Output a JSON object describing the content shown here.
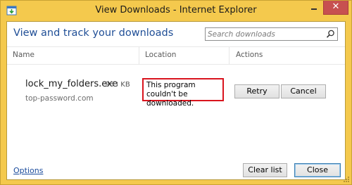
{
  "window": {
    "title": "View Downloads - Internet Explorer",
    "close_glyph": "✕"
  },
  "header": {
    "heading": "View and track your downloads",
    "search_placeholder": "Search downloads"
  },
  "columns": {
    "name": "Name",
    "location": "Location",
    "actions": "Actions"
  },
  "download": {
    "filename": "lock_my_folders.exe",
    "size": "963 KB",
    "source": "top-password.com",
    "status": "This program couldn't be downloaded.",
    "retry_label": "Retry",
    "cancel_label": "Cancel"
  },
  "footer": {
    "options_label": "Options",
    "clear_list_label": "Clear list",
    "close_label": "Close"
  },
  "colors": {
    "frame": "#f4c94d",
    "heading": "#1f4e96",
    "status_border": "#d9141e",
    "close_button": "#c75050"
  },
  "icons": {
    "app": "internet-explorer-download-icon",
    "search": "magnifier-icon"
  }
}
